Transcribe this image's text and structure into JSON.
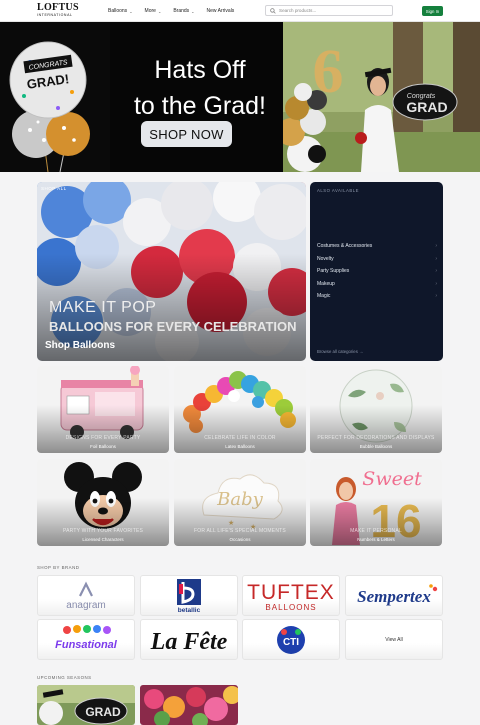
{
  "header": {
    "logo": {
      "word": "LOFTUS",
      "sub": "INTERNATIONAL"
    },
    "nav": [
      {
        "label": "Balloons",
        "has_menu": true
      },
      {
        "label": "More",
        "has_menu": true
      },
      {
        "label": "Brands",
        "has_menu": true
      },
      {
        "label": "New Arrivals",
        "has_menu": false
      }
    ],
    "search_placeholder": "Search products...",
    "signin_label": "Sign In"
  },
  "hero": {
    "title_line1": "Hats Off",
    "title_line2": "to the Grad!",
    "cta": "SHOP NOW",
    "balloon_left_text_1": "CONGRATS",
    "balloon_left_text_2": "GRAD!",
    "balloon_right_text_1": "Congrats",
    "balloon_right_text_2": "GRAD",
    "number_balloon": "6"
  },
  "shop_all": {
    "tag": "SHOP ALL",
    "line1": "MAKE IT POP",
    "line2": "BALLOONS FOR EVERY CELEBRATION",
    "cta": "Shop Balloons"
  },
  "also_available": {
    "tag": "ALSO AVAILABLE",
    "items": [
      "Costumes & Accessories",
      "Novelty",
      "Party Supplies",
      "Makeup",
      "Magic"
    ],
    "footer": "Browse all categories →"
  },
  "categories": [
    {
      "tagline": "DESIGNS FOR EVERY PARTY",
      "name": "Foil Balloons"
    },
    {
      "tagline": "CELEBRATE LIFE IN COLOR",
      "name": "Latex Balloons"
    },
    {
      "tagline": "PERFECT FOR DECORATIONS AND DISPLAYS",
      "name": "Bubble Balloons"
    },
    {
      "tagline": "PARTY WITH YOUR FAVORITES",
      "name": "Licensed Characters"
    },
    {
      "tagline": "FOR ALL LIFE'S SPECIAL MOMENTS",
      "name": "Occasions"
    },
    {
      "tagline": "MAKE IT PERSONAL",
      "name": "Numbers & Letters"
    }
  ],
  "category_art_text": {
    "baby": "Baby",
    "sweet": "Sweet",
    "sixteen": "16"
  },
  "brands_section": {
    "label": "SHOP BY BRAND",
    "brands": [
      {
        "name": "anagram"
      },
      {
        "name": "betallic"
      },
      {
        "name": "TUFTEX",
        "sub": "BALLOONS"
      },
      {
        "name": "Sempertex"
      },
      {
        "name": "Funsational"
      },
      {
        "name": "La Fête"
      },
      {
        "name": "CTI"
      }
    ],
    "view_all": "View All"
  },
  "upcoming": {
    "label": "UPCOMING SEASONS",
    "grad_text": "GRAD"
  },
  "colors": {
    "signin_bg": "#15803d",
    "hero_bg": "#060606",
    "also_bg": "#0f172a",
    "tuftex_red": "#c62828",
    "sempertex_blue": "#1e3a8a"
  }
}
